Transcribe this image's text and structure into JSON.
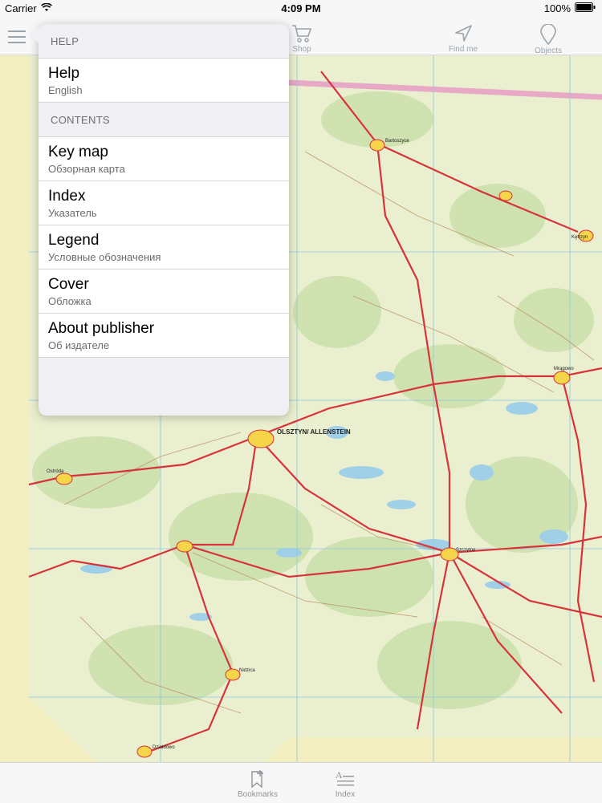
{
  "status_bar": {
    "carrier": "Carrier",
    "time": "4:09 PM",
    "battery": "100%"
  },
  "toolbar": {
    "shop_label": "Shop",
    "find_me_label": "Find me",
    "objects_label": "Objects"
  },
  "menu": {
    "help_header": "HELP",
    "help_items": [
      {
        "title": "Help",
        "subtitle": "English"
      }
    ],
    "contents_header": "CONTENTS",
    "contents_items": [
      {
        "title": "Key map",
        "subtitle": "Обзорная карта"
      },
      {
        "title": "Index",
        "subtitle": "Указатель"
      },
      {
        "title": "Legend",
        "subtitle": "Условные обозначения"
      },
      {
        "title": "Cover",
        "subtitle": "Обложка"
      },
      {
        "title": "About publisher",
        "subtitle": "Об издателе"
      }
    ]
  },
  "map": {
    "labels": [
      "OLSZTYN/ ALLENSTEIN",
      "Bartoszyce",
      "Kętrzyn",
      "Mrągowo",
      "Szczytno",
      "Nidzica",
      "Ostróda",
      "Działdowo"
    ]
  },
  "tabbar": {
    "bookmarks_label": "Bookmarks",
    "index_label": "Index"
  },
  "colors": {
    "accent": "#9aa4ad",
    "map_background": "#e9efc9",
    "road": "#d7333a"
  }
}
